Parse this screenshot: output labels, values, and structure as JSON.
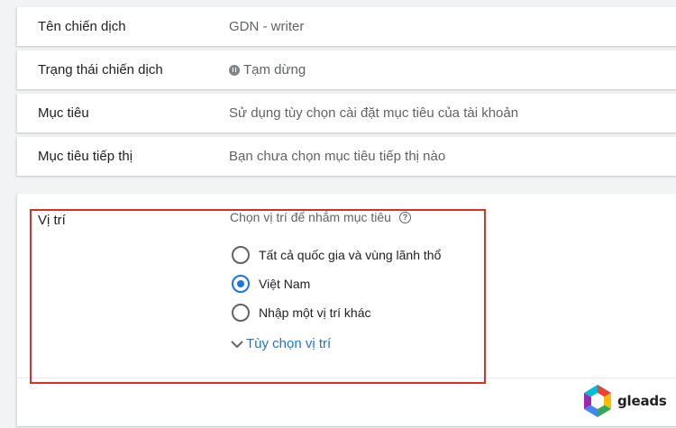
{
  "settings": {
    "rows": [
      {
        "label": "Tên chiến dịch",
        "value": "GDN - writer"
      },
      {
        "label": "Trạng thái chiến dịch",
        "value": "Tạm dừng"
      },
      {
        "label": "Mục tiêu",
        "value": "Sử dụng tùy chọn cài đặt mục tiêu của tài khoản"
      },
      {
        "label": "Mục tiêu tiếp thị",
        "value": "Bạn chưa chọn mục tiêu tiếp thị nào"
      }
    ]
  },
  "location": {
    "label": "Vị trí",
    "prompt": "Chọn vị trí để nhắm mục tiêu",
    "options": [
      {
        "label": "Tất cả quốc gia và vùng lãnh thổ",
        "selected": false
      },
      {
        "label": "Việt Nam",
        "selected": true
      },
      {
        "label": "Nhập một vị trí khác",
        "selected": false
      }
    ],
    "more_options": "Tùy chọn vị trí"
  },
  "logo": {
    "text": "gleads"
  },
  "colors": {
    "accent": "#1a73e8",
    "highlight": "#d93025"
  },
  "icons": {
    "status": "pause-circle-icon",
    "help": "help-icon",
    "expand": "chevron-down-icon"
  }
}
